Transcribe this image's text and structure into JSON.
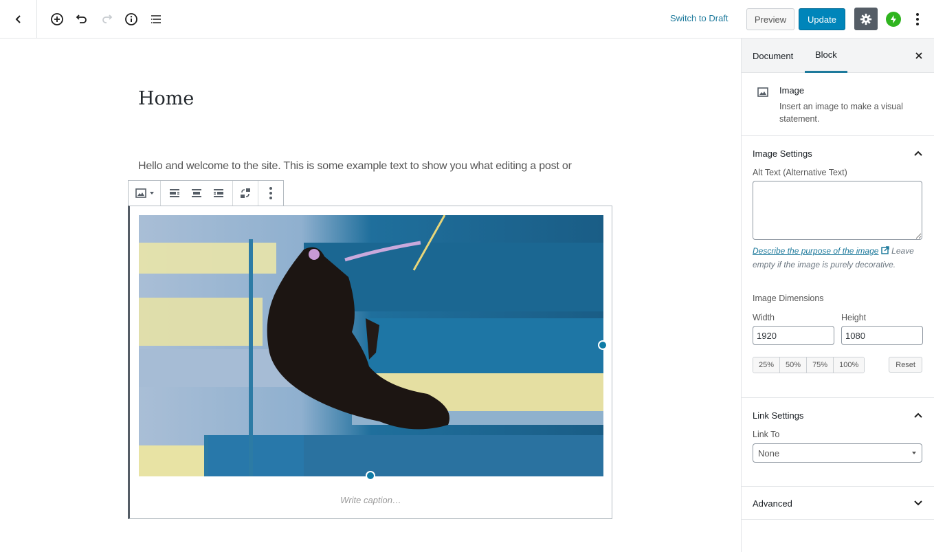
{
  "topbar": {
    "switch_to_draft": "Switch to Draft",
    "preview": "Preview",
    "update": "Update",
    "icons": [
      "back-chevron-icon",
      "add-block-icon",
      "undo-icon",
      "redo-icon",
      "info-icon",
      "outline-icon",
      "gear-icon",
      "jetpack-icon",
      "more-vertical-icon"
    ]
  },
  "editor": {
    "title": "Home",
    "paragraph": "Hello and welcome to the site. This is some example text to show you what editing a post or",
    "caption_placeholder": "Write caption…"
  },
  "sidebar": {
    "tabs": [
      {
        "label": "Document",
        "active": false
      },
      {
        "label": "Block",
        "active": true
      }
    ],
    "block": {
      "title": "Image",
      "description": "Insert an image to make a visual statement."
    },
    "image_settings": {
      "title": "Image Settings",
      "alt_label": "Alt Text (Alternative Text)",
      "alt_value": "",
      "help_link": "Describe the purpose of the image",
      "help_rest": "Leave empty if the image is purely decorative.",
      "dimensions_label": "Image Dimensions",
      "width_label": "Width",
      "width_value": "1920",
      "height_label": "Height",
      "height_value": "1080",
      "percent_buttons": [
        "25%",
        "50%",
        "75%",
        "100%"
      ],
      "reset": "Reset"
    },
    "link_settings": {
      "title": "Link Settings",
      "link_to_label": "Link To",
      "link_to_value": "None"
    },
    "advanced": {
      "title": "Advanced"
    }
  },
  "colors": {
    "accent": "#0085ba",
    "link": "#1e7a9c",
    "jetpack": "#2fb41f",
    "dark_button": "#555d66"
  }
}
